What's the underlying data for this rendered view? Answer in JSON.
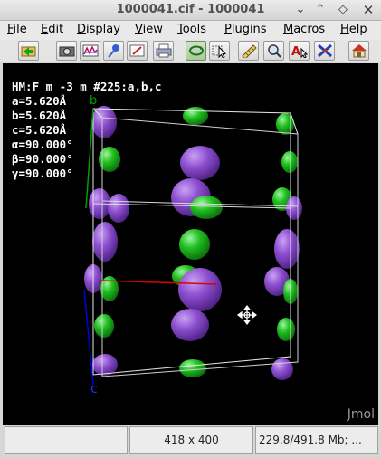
{
  "window": {
    "title": "1000041.cif - 1000041"
  },
  "menus": [
    {
      "label": "File",
      "mnemonic": "F"
    },
    {
      "label": "Edit",
      "mnemonic": "E"
    },
    {
      "label": "Display",
      "mnemonic": "D"
    },
    {
      "label": "View",
      "mnemonic": "V"
    },
    {
      "label": "Tools",
      "mnemonic": "T"
    },
    {
      "label": "Plugins",
      "mnemonic": "P"
    },
    {
      "label": "Macros",
      "mnemonic": "M"
    },
    {
      "label": "Help",
      "mnemonic": "H"
    }
  ],
  "toolbar": [
    "open-file-icon",
    "screenshot-icon",
    "spectrum-icon",
    "pin-icon",
    "edit-icon",
    "print-icon",
    "rotate-icon",
    "select-icon",
    "measure-icon",
    "zoom-icon",
    "label-icon",
    "tools-icon",
    "home-icon"
  ],
  "viewer": {
    "info_lines": [
      "HM:F m -3 m #225:a,b,c",
      "a=5.620Å",
      "b=5.620Å",
      "c=5.620Å",
      "α=90.000°",
      "β=90.000°",
      "γ=90.000°"
    ],
    "axes": {
      "b": "b",
      "c": "c",
      "a": ""
    },
    "brand": "Jmol",
    "colors": {
      "background": "#000000",
      "atom_purple": "#8e4fd0",
      "atom_green": "#1fbd1f",
      "axis_a": "#e00000",
      "axis_b": "#00a000",
      "axis_c": "#0000e0"
    }
  },
  "status": {
    "left": "",
    "size": "418 x 400",
    "memory": "229.8/491.8 Mb; ..."
  }
}
